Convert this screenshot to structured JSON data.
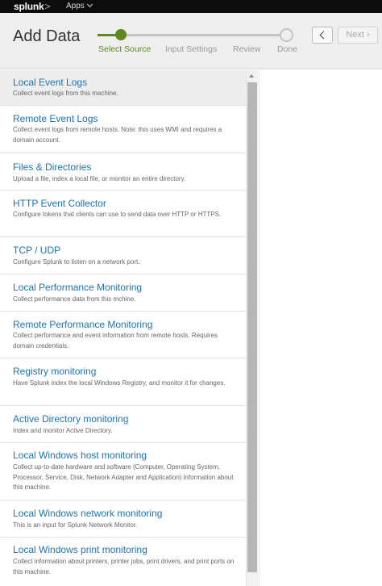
{
  "topbar": {
    "logo": "splunk",
    "logo_suffix": ">",
    "apps_label": "Apps"
  },
  "header": {
    "title": "Add Data",
    "steps": [
      "Select Source",
      "Input Settings",
      "Review",
      "Done"
    ],
    "current_step": "Select Source",
    "next_label": "Next"
  },
  "sources": [
    {
      "title": "Local Event Logs",
      "desc": "Collect event logs from this machine."
    },
    {
      "title": "Remote Event Logs",
      "desc": "Collect event logs from remote hosts. Note: this uses WMI and requires a domain account."
    },
    {
      "title": "Files & Directories",
      "desc": "Upload a file, index a local file, or monitor an entire directory."
    },
    {
      "title": "HTTP Event Collector",
      "desc": "Configure tokens that clients can use to send data over HTTP or HTTPS."
    },
    {
      "title": "TCP / UDP",
      "desc": "Configure Splunk to listen on a network port."
    },
    {
      "title": "Local Performance Monitoring",
      "desc": "Collect performance data from this mchine."
    },
    {
      "title": "Remote Performance Monitoring",
      "desc": "Collect performance and event information from remote hosts. Requires domain credentials."
    },
    {
      "title": "Registry monitoring",
      "desc": "Have Splunk index the local Windows Registry, and monitor it for changes."
    },
    {
      "title": "Active Directory monitoring",
      "desc": "Index and monitor Active Directory."
    },
    {
      "title": "Local Windows host monitoring",
      "desc": "Collect up-to-date hardware and software (Computer, Operating System, Processor, Service, Disk, Network Adapter and Application) information about this machine."
    },
    {
      "title": "Local Windows network monitoring",
      "desc": "This is an input for Splunk Network Monitor."
    },
    {
      "title": "Local Windows print monitoring",
      "desc": "Collect information about printers, printer jobs, print drivers, and print ports on this machine."
    }
  ],
  "selected_source": "Local Event Logs",
  "icons": {
    "apps_dropdown": "chevron-down-icon",
    "back": "chevron-left-icon",
    "next": "chevron-right-icon",
    "scroll_up": "triangle-up-icon"
  },
  "colors": {
    "accent": "#5c8a1f",
    "link": "#1e73be",
    "topbar": "#0c0c0c"
  }
}
